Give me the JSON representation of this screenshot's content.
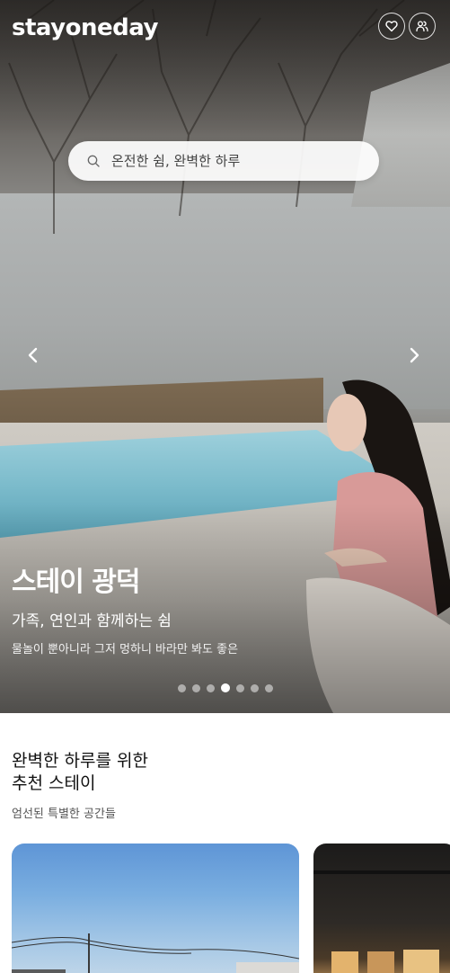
{
  "header": {
    "logo": "stayoneday",
    "wishlist_icon": "heart-icon",
    "account_icon": "user-group-icon"
  },
  "search": {
    "placeholder": "온전한 쉼, 완벽한 하루",
    "icon": "search-icon"
  },
  "hero": {
    "title": "스테이 광덕",
    "subtitle": "가족, 연인과 함께하는 쉼",
    "description": "물놀이 뿐아니라 그저 멍하니 바라만 봐도 좋은",
    "slide_count": 7,
    "active_slide": 4,
    "prev_icon": "chevron-left-icon",
    "next_icon": "chevron-right-icon"
  },
  "recommend": {
    "title_line1": "완벽한 하루를 위한",
    "title_line2": "추천 스테이",
    "subtitle": "엄선된 특별한 공간들"
  },
  "colors": {
    "text_primary": "#111111",
    "text_secondary": "#555555",
    "on_image": "#ffffff"
  }
}
